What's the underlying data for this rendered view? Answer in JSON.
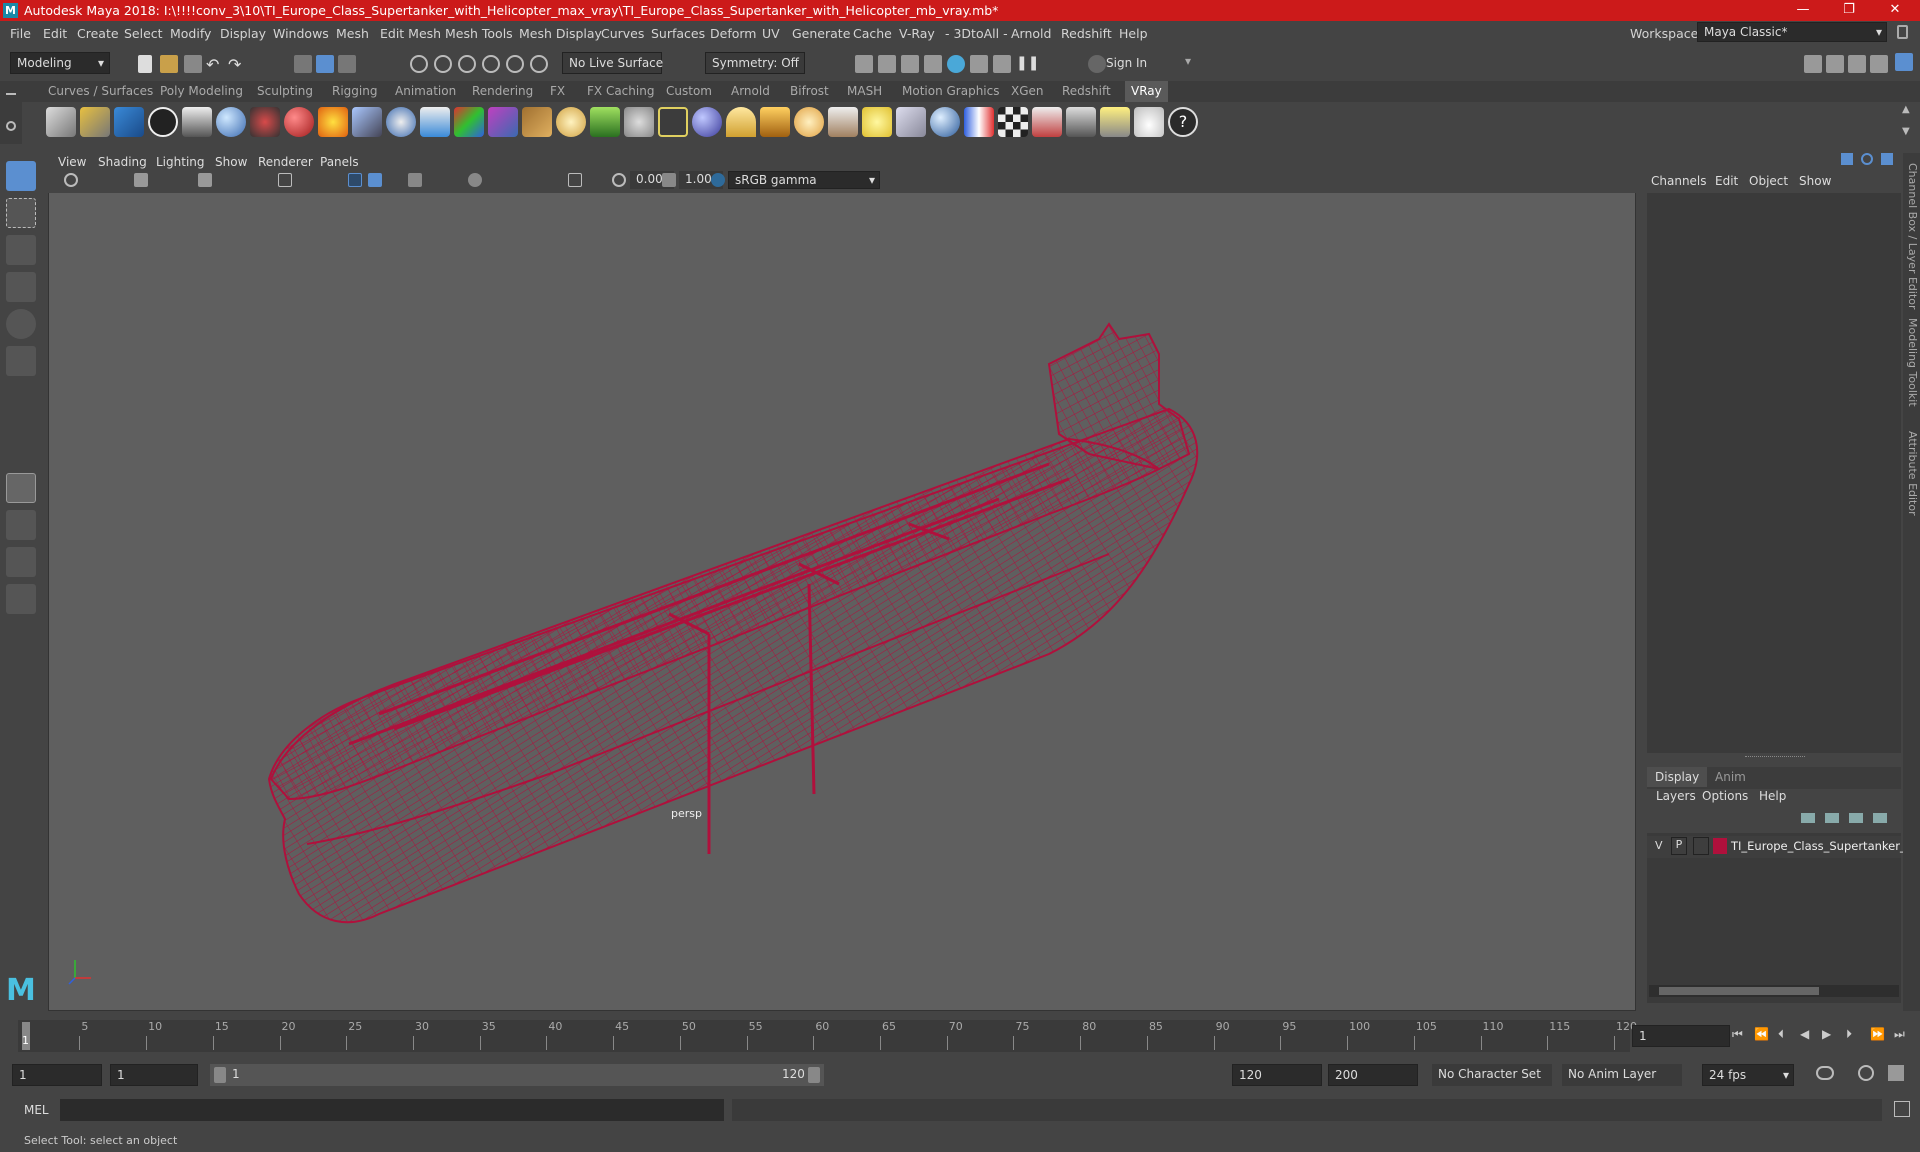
{
  "window": {
    "title": "Autodesk Maya 2018: I:\\!!!!conv_3\\10\\TI_Europe_Class_Supertanker_with_Helicopter_max_vray\\TI_Europe_Class_Supertanker_with_Helicopter_mb_vray.mb*",
    "logo_letter": "M",
    "minimize": "—",
    "maximize": "❐",
    "close": "✕"
  },
  "menus": [
    "File",
    "Edit",
    "Create",
    "Select",
    "Modify",
    "Display",
    "Windows",
    "Mesh",
    "Edit Mesh",
    "Mesh Tools",
    "Mesh Display",
    "Curves",
    "Surfaces",
    "Deform",
    "UV",
    "Generate",
    "Cache",
    "V-Ray",
    "- 3DtoAll -",
    "Arnold",
    "Redshift",
    "Help"
  ],
  "workspace": {
    "label": "Workspace :",
    "value": "Maya Classic*"
  },
  "statusline": {
    "mode": "Modeling",
    "live_surface": "No Live Surface",
    "symmetry": "Symmetry: Off",
    "sign_in": "Sign In"
  },
  "shelf_tabs": [
    "Curves / Surfaces",
    "Poly Modeling",
    "Sculpting",
    "Rigging",
    "Animation",
    "Rendering",
    "FX",
    "FX Caching",
    "Custom",
    "Arnold",
    "Bifrost",
    "MASH",
    "Motion Graphics",
    "XGen",
    "Redshift",
    "VRay"
  ],
  "shelf_active": "VRay",
  "viewport": {
    "menus": [
      "View",
      "Shading",
      "Lighting",
      "Show",
      "Renderer",
      "Panels"
    ],
    "exposure": "0.00",
    "gamma": "1.00",
    "color_space": "sRGB gamma",
    "camera_label": "persp",
    "wire_color": "#b0103c"
  },
  "channel_box": {
    "menus": [
      "Channels",
      "Edit",
      "Object",
      "Show"
    ]
  },
  "layer_editor": {
    "tabs": [
      "Display",
      "Anim"
    ],
    "menus": [
      "Layers",
      "Options",
      "Help"
    ],
    "layer": {
      "v": "V",
      "p": "P",
      "name": "TI_Europe_Class_Supertanker_",
      "color": "#b0103c"
    }
  },
  "side_tabs": [
    "Channel Box / Layer Editor",
    "Modeling Toolkit",
    "Attribute Editor"
  ],
  "timeline": {
    "ticks": [
      "5",
      "10",
      "15",
      "20",
      "25",
      "30",
      "35",
      "40",
      "45",
      "50",
      "55",
      "60",
      "65",
      "70",
      "75",
      "80",
      "85",
      "90",
      "95",
      "100",
      "105",
      "110",
      "115",
      "120"
    ],
    "current_frame_marker": "1",
    "current_frame": "1"
  },
  "range": {
    "start": "1",
    "playback_start": "1",
    "slider_start": "1",
    "slider_end": "120",
    "playback_end": "120",
    "end": "200",
    "character_set": "No Character Set",
    "anim_layer": "No Anim Layer",
    "fps": "24 fps"
  },
  "command": {
    "label": "MEL"
  },
  "help_line": "Select Tool: select an object"
}
